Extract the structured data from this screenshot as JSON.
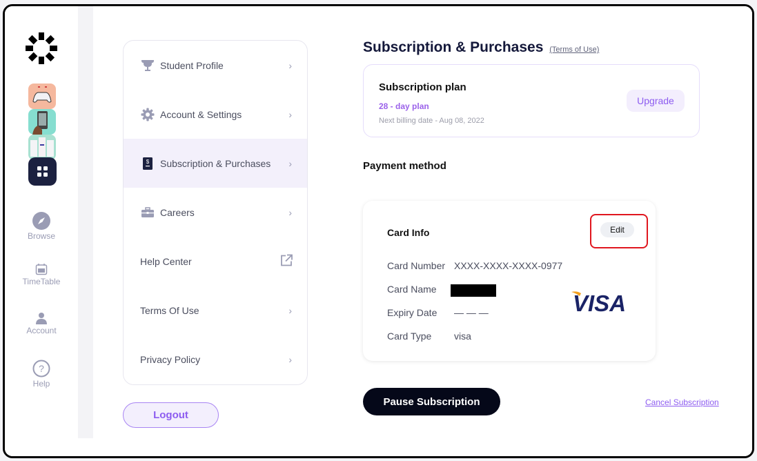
{
  "sidebar": {
    "logo": "brand-logo",
    "apps": [
      {
        "name": "gamepad-app-thumbnail"
      },
      {
        "name": "phone-app-thumbnail"
      },
      {
        "name": "screens-app-thumbnail"
      }
    ],
    "nav": [
      {
        "label": "Browse",
        "icon": "compass-icon"
      },
      {
        "label": "TimeTable",
        "icon": "calendar-icon"
      },
      {
        "label": "Account",
        "icon": "user-icon"
      },
      {
        "label": "Help",
        "icon": "help-icon"
      }
    ]
  },
  "menu": {
    "items": [
      {
        "label": "Student Profile",
        "icon": "trophy-icon",
        "trailing": "chevron-right-icon",
        "active": false
      },
      {
        "label": "Account & Settings",
        "icon": "gear-icon",
        "trailing": "chevron-right-icon",
        "active": false
      },
      {
        "label": "Subscription & Purchases",
        "icon": "receipt-icon",
        "trailing": "chevron-right-icon",
        "active": true
      },
      {
        "label": "Careers",
        "icon": "briefcase-icon",
        "trailing": "chevron-right-icon",
        "active": false
      },
      {
        "label": "Help Center",
        "icon": null,
        "trailing": "external-link-icon",
        "active": false
      },
      {
        "label": "Terms Of Use",
        "icon": null,
        "trailing": "chevron-right-icon",
        "active": false
      },
      {
        "label": "Privacy Policy",
        "icon": null,
        "trailing": "chevron-right-icon",
        "active": false
      }
    ],
    "chevron": "›",
    "logout_label": "Logout"
  },
  "page": {
    "title": "Subscription & Purchases",
    "terms_link": "(Terms of Use)"
  },
  "plan": {
    "title": "Subscription plan",
    "name": "28 - day plan",
    "billing": "Next billing date - Aug 08, 2022",
    "upgrade_label": "Upgrade"
  },
  "payment": {
    "title": "Payment method",
    "card_info_title": "Card Info",
    "edit_label": "Edit",
    "rows": [
      {
        "label": "Card Number",
        "value": "XXXX-XXXX-XXXX-0977"
      },
      {
        "label": "Card Name",
        "value": ""
      },
      {
        "label": "Expiry Date",
        "value": "— — —"
      },
      {
        "label": "Card Type",
        "value": "visa"
      }
    ],
    "brand_logo_text": "VISA"
  },
  "actions": {
    "pause_label": "Pause Subscription",
    "cancel_label": "Cancel Subscription"
  },
  "colors": {
    "accent": "#8d5cf0",
    "dark": "#050819",
    "highlight": "#e0161e"
  }
}
